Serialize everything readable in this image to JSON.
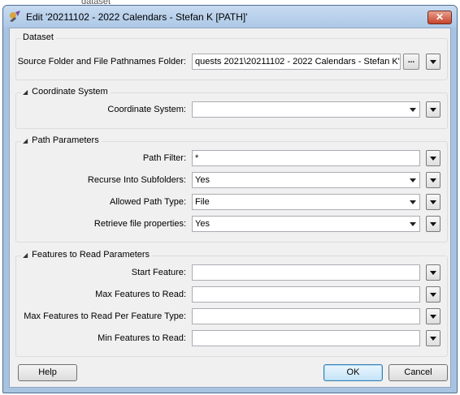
{
  "window": {
    "title": "Edit '20211102 - 2022 Calendars - Stefan K [PATH]'",
    "close_symbol": "✕"
  },
  "background": {
    "ghost_text": "dataset"
  },
  "sections": {
    "dataset": {
      "header": "Dataset",
      "source_label": "Source Folder and File Pathnames Folder:",
      "source_value": "quests 2021\\20211102 - 2022 Calendars - Stefan K\"",
      "browse_label": "..."
    },
    "coordinate_system": {
      "header": "Coordinate System",
      "label": "Coordinate System:",
      "value": ""
    },
    "path_parameters": {
      "header": "Path Parameters",
      "path_filter_label": "Path Filter:",
      "path_filter_value": "*",
      "recurse_label": "Recurse Into Subfolders:",
      "recurse_value": "Yes",
      "allowed_type_label": "Allowed Path Type:",
      "allowed_type_value": "File",
      "retrieve_label": "Retrieve file properties:",
      "retrieve_value": "Yes"
    },
    "features": {
      "header": "Features to Read Parameters",
      "start_label": "Start Feature:",
      "start_value": "",
      "max_label": "Max Features to Read:",
      "max_value": "",
      "max_per_type_label": "Max Features to Read Per Feature Type:",
      "max_per_type_value": "",
      "min_label": "Min Features to Read:",
      "min_value": ""
    }
  },
  "buttons": {
    "help": "Help",
    "ok": "OK",
    "cancel": "Cancel"
  },
  "icons": {
    "app": "fme-workbench-icon",
    "collapse": "collapse-triangle-icon",
    "menu": "dropdown-menu-icon"
  },
  "colors": {
    "title_bar": "#adc8e6",
    "close_button": "#c7432c",
    "dialog_bg": "#f0f0f0",
    "default_button_border": "#3c7fb1"
  }
}
